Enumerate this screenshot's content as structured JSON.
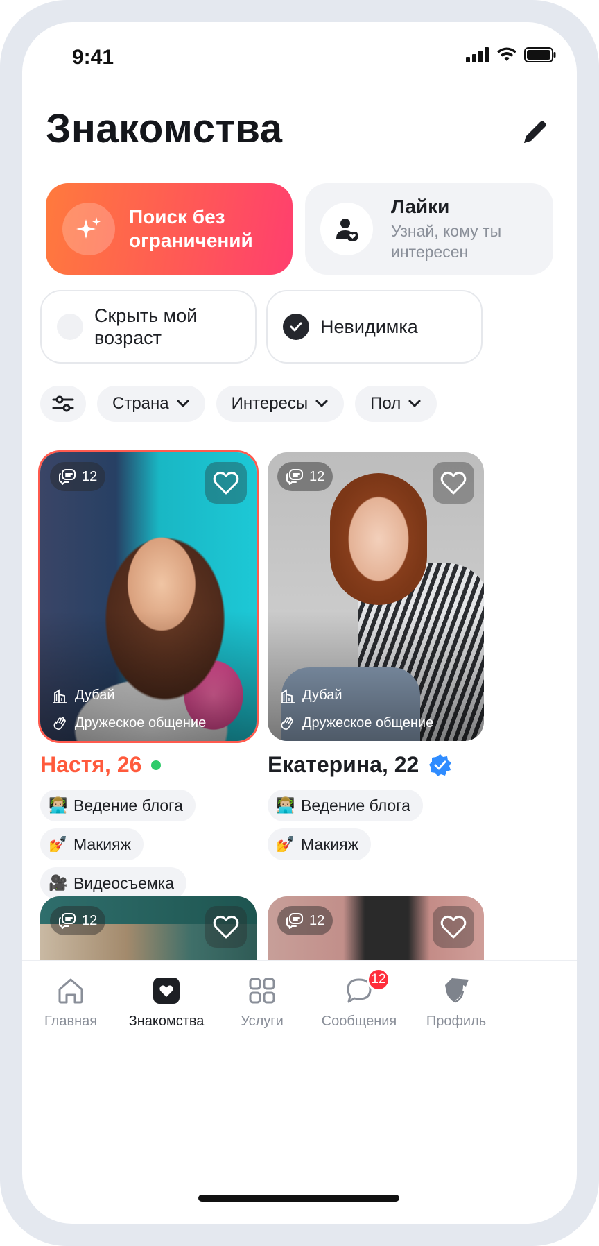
{
  "status_bar": {
    "time": "9:41"
  },
  "header": {
    "title": "Знакомства"
  },
  "promo": {
    "label": "Поиск без ограничений"
  },
  "likes": {
    "title": "Лайки",
    "subtitle": "Узнай, кому ты интересен"
  },
  "toggles": [
    {
      "label": "Скрыть мой возраст",
      "checked": false
    },
    {
      "label": "Невидимка",
      "checked": true
    }
  ],
  "filters": [
    {
      "label": "Страна"
    },
    {
      "label": "Интересы"
    },
    {
      "label": "Пол"
    }
  ],
  "profiles": [
    {
      "name": "Настя, 26",
      "comments": "12",
      "city": "Дубай",
      "goal": "Дружеское общение",
      "online": true,
      "verified": false,
      "interests": [
        {
          "emoji": "👨🏼‍💻",
          "label": "Ведение блога"
        },
        {
          "emoji": "💅",
          "label": "Макияж"
        },
        {
          "emoji": "🎥",
          "label": "Видеосъемка"
        }
      ]
    },
    {
      "name": "Екатерина, 22",
      "comments": "12",
      "city": "Дубай",
      "goal": "Дружеское общение",
      "online": false,
      "verified": true,
      "interests": [
        {
          "emoji": "👨🏼‍💻",
          "label": "Ведение блога"
        },
        {
          "emoji": "💅",
          "label": "Макияж"
        }
      ]
    }
  ],
  "more_profiles": [
    {
      "comments": "12"
    },
    {
      "comments": "12"
    }
  ],
  "tabbar": {
    "items": [
      {
        "label": "Главная",
        "icon": "home-icon",
        "active": false
      },
      {
        "label": "Знакомства",
        "icon": "heart-icon",
        "active": true
      },
      {
        "label": "Услуги",
        "icon": "grid-icon",
        "active": false
      },
      {
        "label": "Сообщения",
        "icon": "chat-icon",
        "active": false,
        "badge": "12"
      },
      {
        "label": "Профиль",
        "icon": "avatar-icon",
        "active": false
      }
    ]
  },
  "colors": {
    "accent": "#ff5a3c",
    "online": "#2ecb6a",
    "badge": "#ff2d3b",
    "verified": "#2f8cff"
  }
}
